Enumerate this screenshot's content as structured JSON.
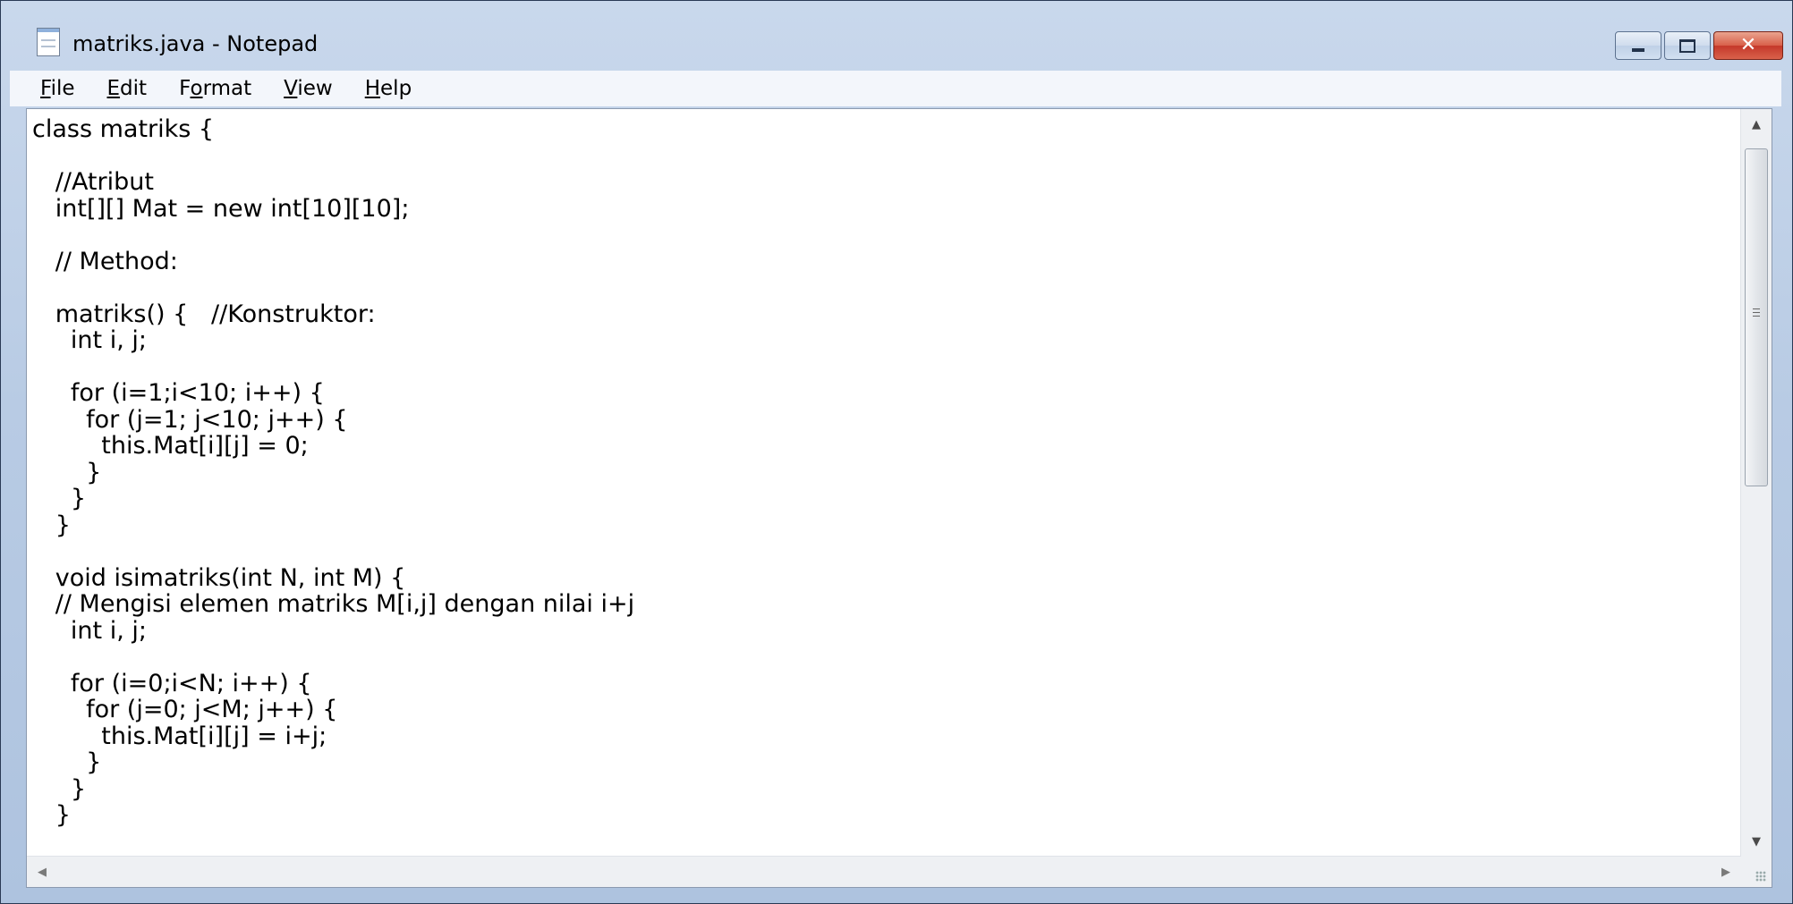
{
  "window": {
    "title": "matriks.java - Notepad",
    "close_glyph": "✕"
  },
  "menu": {
    "file": {
      "u": "F",
      "rest": "ile"
    },
    "edit": {
      "u": "E",
      "rest": "dit"
    },
    "format": {
      "pre": "F",
      "u": "o",
      "rest": "rmat"
    },
    "view": {
      "u": "V",
      "rest": "iew"
    },
    "help": {
      "u": "H",
      "rest": "elp"
    }
  },
  "editor": {
    "content": "class matriks {\n\n   //Atribut\n   int[][] Mat = new int[10][10];\n\n   // Method:\n\n   matriks() {   //Konstruktor:\n     int i, j;\n\n     for (i=1;i<10; i++) {\n       for (j=1; j<10; j++) {\n         this.Mat[i][j] = 0;\n       }\n     }\n   }\n\n   void isimatriks(int N, int M) {\n   // Mengisi elemen matriks M[i,j] dengan nilai i+j\n     int i, j;\n\n     for (i=0;i<N; i++) {\n       for (j=0; j<M; j++) {\n         this.Mat[i][j] = i+j;\n       }\n     }\n   }"
  },
  "scrollbars": {
    "up_arrow": "▲",
    "down_arrow": "▼",
    "left_arrow": "◀",
    "right_arrow": "▶"
  },
  "colors": {
    "titlebar": "#b8cbe4",
    "close_button": "#c4382a",
    "menubar": "#f3f6fb"
  },
  "icons": [
    "notepad-icon",
    "minimize-icon",
    "maximize-icon",
    "close-icon",
    "size-grip-icon"
  ]
}
